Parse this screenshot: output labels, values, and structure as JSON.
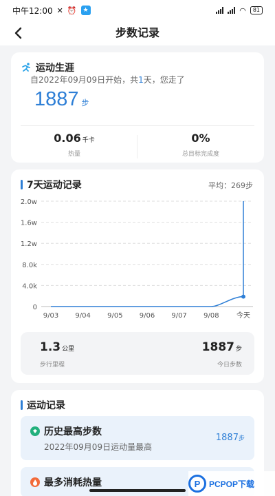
{
  "status_bar": {
    "time": "中午12:00",
    "battery": "81"
  },
  "nav": {
    "title": "步数记录"
  },
  "career": {
    "title": "运动生涯",
    "sub_prefix": "自2022年09月09日开始，共",
    "sub_days": "1",
    "sub_suffix": "天，您走了",
    "steps": "1887",
    "steps_unit": "步",
    "calories_value": "0.06",
    "calories_unit": "千卡",
    "calories_label": "热量",
    "goal_value": "0%",
    "goal_label": "总目标完成度"
  },
  "week": {
    "title": "7天运动记录",
    "average": "平均：269步",
    "steps_total_value": "1.3",
    "steps_total_unit": "公里",
    "distance_label": "步行里程",
    "today_value": "1887",
    "today_unit": "步",
    "today_label": "今日步数"
  },
  "chart_data": {
    "type": "line",
    "title": "7天运动记录",
    "categories": [
      "9/03",
      "9/04",
      "9/05",
      "9/06",
      "9/07",
      "9/08",
      "今天"
    ],
    "series": [
      {
        "values": [
          0,
          0,
          0,
          0,
          0,
          0,
          1887
        ]
      }
    ],
    "y_ticks": [
      "0",
      "4.0k",
      "8.0k",
      "1.2w",
      "1.6w",
      "2.0w"
    ],
    "y_tick_values": [
      0,
      4000,
      8000,
      12000,
      16000,
      20000
    ],
    "ylim": [
      0,
      20000
    ],
    "grid": true,
    "line_color": "#2e7fd6"
  },
  "records": {
    "title": "运动记录",
    "items": [
      {
        "title": "历史最高步数",
        "desc": "2022年09月09日运动量最高",
        "value": "1887",
        "unit": "步"
      },
      {
        "title": "最多消耗热量"
      }
    ]
  },
  "watermark": {
    "text": "PCPOP下载",
    "logo_letter": "P"
  },
  "colors": {
    "accent": "#2e7fd6",
    "background": "#f3f4f6",
    "record_bg": "#eaf2fb"
  }
}
